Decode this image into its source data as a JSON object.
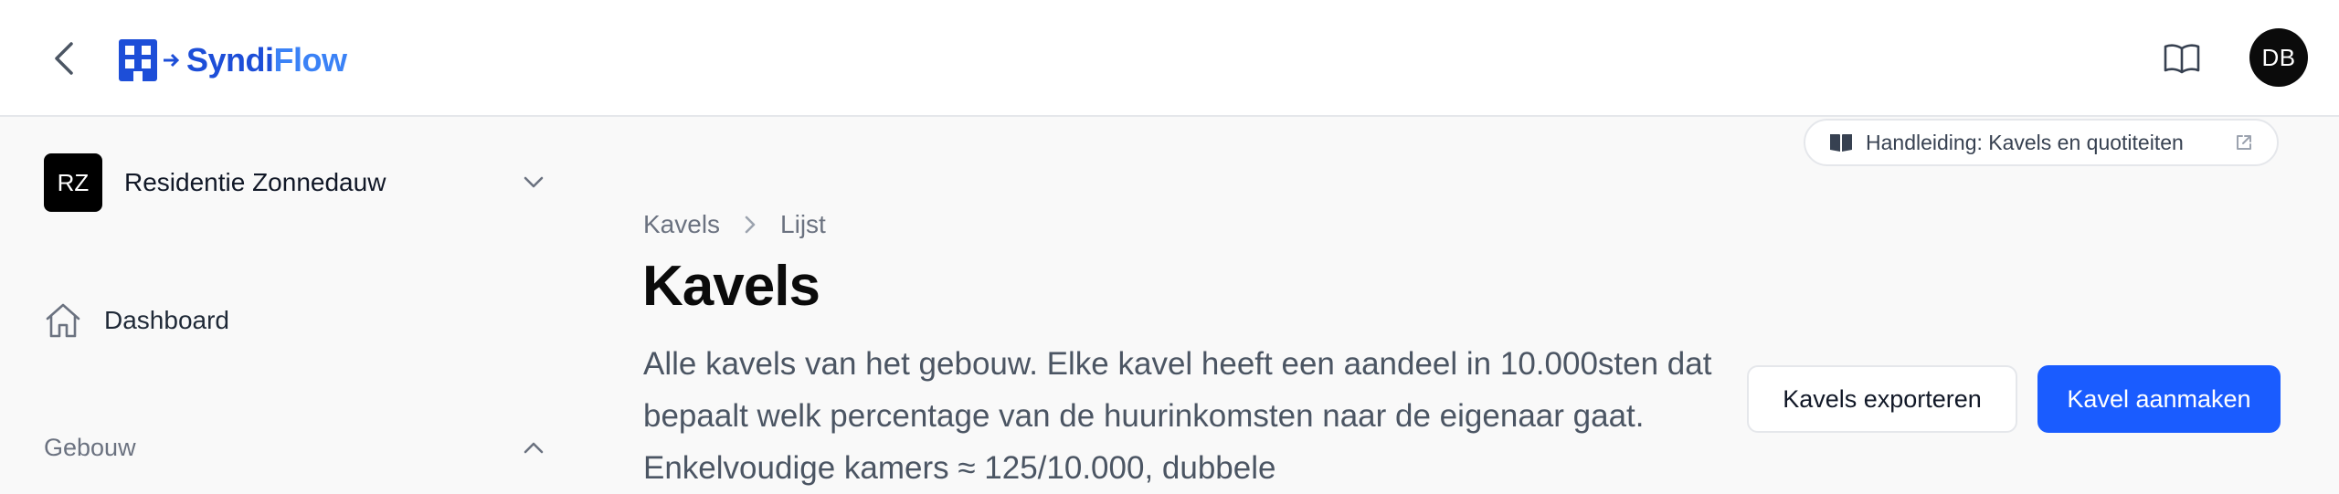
{
  "header": {
    "back_icon": "chevron-left-icon",
    "logo": {
      "part1": "Syndi",
      "part2": "Flow",
      "icon": "building-arrow-icon"
    },
    "manual_icon": "book-open-icon",
    "avatar_initials": "DB",
    "brand_color": "#1d4ed8"
  },
  "sidebar": {
    "building": {
      "initials": "RZ",
      "name": "Residentie Zonnedauw",
      "icon": "chevron-down-icon"
    },
    "nav": [
      {
        "label": "Dashboard",
        "icon": "home-icon"
      }
    ],
    "sections": [
      {
        "label": "Gebouw",
        "icon": "chevron-up-icon"
      }
    ]
  },
  "manual_link": {
    "label": "Handleiding: Kavels en quotiteiten",
    "icon": "book-icon",
    "external_icon": "external-link-icon"
  },
  "breadcrumb": {
    "items": [
      "Kavels",
      "Lijst"
    ],
    "separator_icon": "chevron-right-icon"
  },
  "page": {
    "title": "Kavels",
    "description": "Alle kavels van het gebouw. Elke kavel heeft een aandeel in 10.000sten dat bepaalt welk percentage van de huurinkomsten naar de eigenaar gaat. Enkelvoudige kamers ≈ 125/10.000, dubbele"
  },
  "actions": {
    "export_label": "Kavels exporteren",
    "create_label": "Kavel aanmaken",
    "primary_color": "#1a5cff"
  }
}
